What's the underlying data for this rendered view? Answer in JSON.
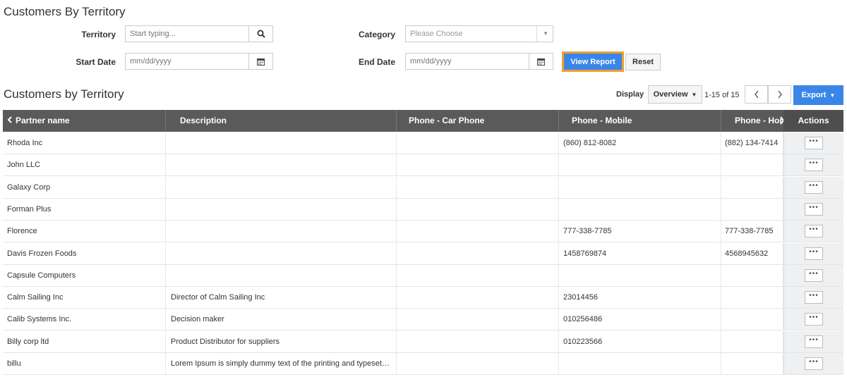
{
  "page": {
    "title": "Customers By Territory"
  },
  "filters": {
    "territory_label": "Territory",
    "territory_placeholder": "Start typing...",
    "category_label": "Category",
    "category_placeholder": "Please Choose",
    "start_date_label": "Start Date",
    "start_date_placeholder": "mm/dd/yyyy",
    "end_date_label": "End Date",
    "end_date_placeholder": "mm/dd/yyyy",
    "view_report": "View Report",
    "reset": "Reset"
  },
  "report": {
    "title": "Customers by Territory",
    "display_label": "Display",
    "display_value": "Overview",
    "pager": "1-15 of 15",
    "export": "Export"
  },
  "table": {
    "headers": {
      "partner": "Partner name",
      "description": "Description",
      "car_phone": "Phone - Car Phone",
      "mobile": "Phone - Mobile",
      "home": "Phone - Hor",
      "actions": "Actions"
    },
    "rows": [
      {
        "partner": "Rhoda Inc",
        "description": "",
        "car_phone": "",
        "mobile": "(860) 812-8082",
        "home": "(882) 134-7414",
        "action": "•••"
      },
      {
        "partner": "John LLC",
        "description": "",
        "car_phone": "",
        "mobile": "",
        "home": "",
        "action": "•••"
      },
      {
        "partner": "Galaxy Corp",
        "description": "",
        "car_phone": "",
        "mobile": "",
        "home": "",
        "action": "•••"
      },
      {
        "partner": "Forman Plus",
        "description": "",
        "car_phone": "",
        "mobile": "",
        "home": "",
        "action": "•••"
      },
      {
        "partner": "Florence",
        "description": "",
        "car_phone": "",
        "mobile": "777-338-7785",
        "home": "777-338-7785",
        "action": "•••"
      },
      {
        "partner": "Davis Frozen Foods",
        "description": "",
        "car_phone": "",
        "mobile": "1458769874",
        "home": "4568945632",
        "action": "•••"
      },
      {
        "partner": "Capsule Computers",
        "description": "",
        "car_phone": "",
        "mobile": "",
        "home": "",
        "action": "•••"
      },
      {
        "partner": "Calm Sailing Inc",
        "description": "Director of Calm Sailing Inc",
        "car_phone": "",
        "mobile": "23014456",
        "home": "",
        "action": "•••"
      },
      {
        "partner": "Calib Systems Inc.",
        "description": "Decision maker",
        "car_phone": "",
        "mobile": "010256486",
        "home": "",
        "action": "•••"
      },
      {
        "partner": "Billy corp ltd",
        "description": "Product Distributor for suppliers",
        "car_phone": "",
        "mobile": "010223566",
        "home": "",
        "action": "•••"
      },
      {
        "partner": "billu",
        "description": "Lorem Ipsum is simply dummy text of the printing and typeset…",
        "car_phone": "",
        "mobile": "",
        "home": "",
        "action": "•••"
      }
    ]
  },
  "colors": {
    "accent": "#3a86e8",
    "focus": "#f0a030",
    "header": "#5a5a5a"
  },
  "icons": [
    "search-icon",
    "calendar-icon",
    "chevron-down-icon",
    "chevron-left-icon",
    "chevron-right-icon",
    "more-icon"
  ]
}
